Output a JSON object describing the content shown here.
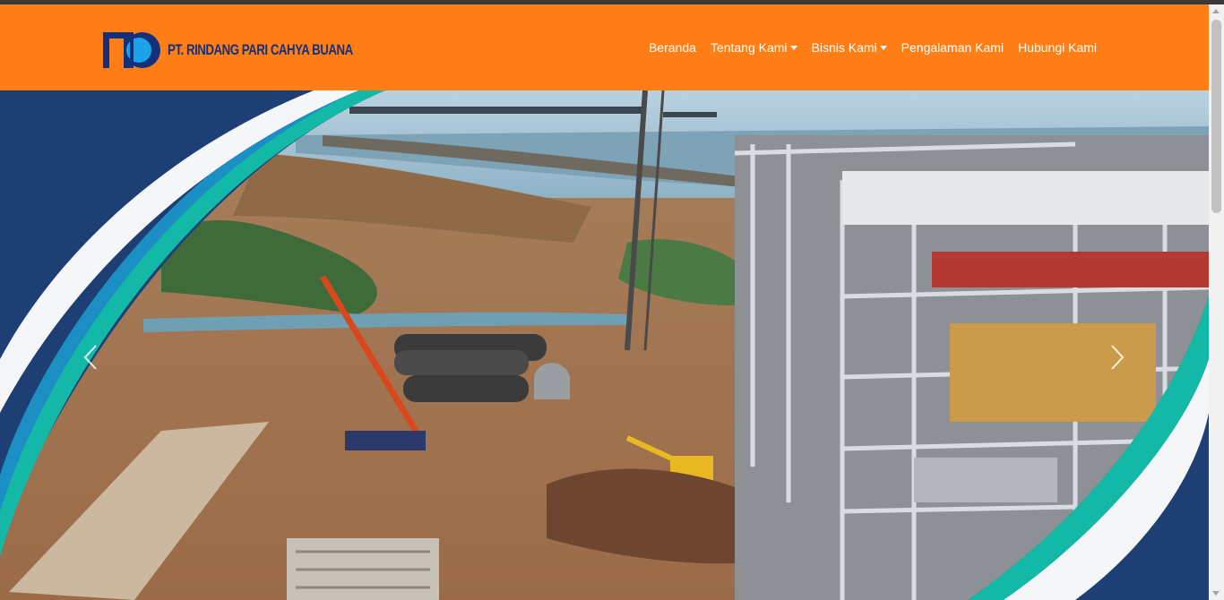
{
  "brand": {
    "name": "PT. RINDANG PARI CAHYA BUANA",
    "logo_icon": "rpcb-logo-icon",
    "colors": {
      "primary": "#15307a",
      "secondary": "#1aa3e8"
    }
  },
  "navbar": {
    "background": "#ff7f16",
    "links": [
      {
        "label": "Beranda",
        "dropdown": false
      },
      {
        "label": "Tentang Kami",
        "dropdown": true
      },
      {
        "label": "Bisnis Kami",
        "dropdown": true
      },
      {
        "label": "Pengalaman Kami",
        "dropdown": false
      },
      {
        "label": "Hubungi Kami",
        "dropdown": false
      }
    ]
  },
  "carousel": {
    "prev_icon": "chevron-left-icon",
    "next_icon": "chevron-right-icon",
    "slide_image": "construction-site-photo",
    "frame_colors": {
      "navy": "#1e3f73",
      "teal": "#14b8a6",
      "blue": "#1b8ec4",
      "white": "#f4f6f8"
    }
  }
}
